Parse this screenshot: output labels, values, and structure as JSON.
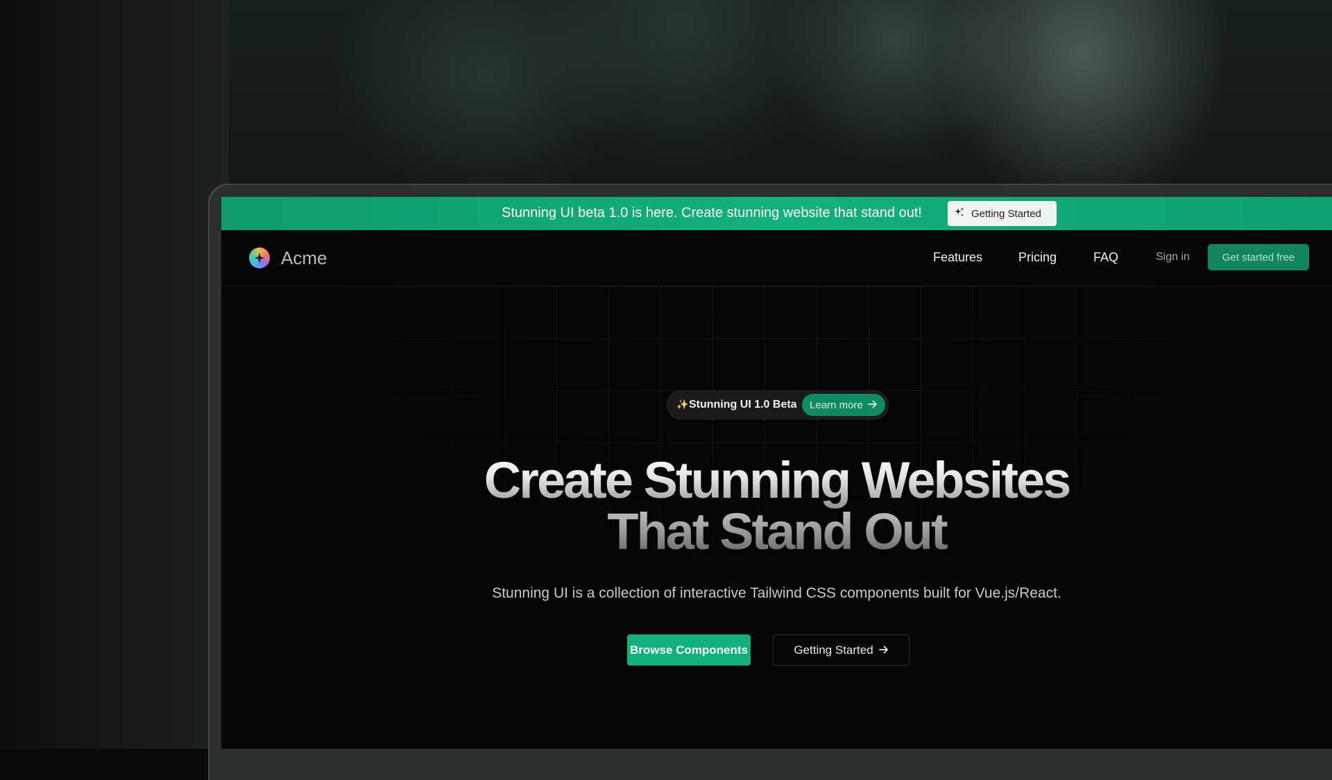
{
  "announcement": {
    "text": "Stunning UI beta 1.0 is here. Create stunning website that stand out!",
    "button_label": "Getting Started",
    "button_icon": "sparkles-icon"
  },
  "nav": {
    "brand": "Acme",
    "logo_icon": "acme-logo-icon",
    "links": [
      {
        "label": "Features"
      },
      {
        "label": "Pricing"
      },
      {
        "label": "FAQ"
      }
    ],
    "sign_in": "Sign in",
    "cta": "Get started free"
  },
  "hero": {
    "badge_text": "Stunning UI 1.0 Beta",
    "badge_icon": "sparkle-icon",
    "badge_link": "Learn more",
    "title_line1": "Create Stunning Websites",
    "title_line2": "That Stand Out",
    "subtitle": "Stunning UI is a collection of interactive Tailwind CSS components built for Vue.js/React.",
    "primary_button": "Browse Components",
    "secondary_button": "Getting Started"
  },
  "colors": {
    "accent": "#12b07c",
    "accent_dark": "#10855e",
    "background": "#050505"
  }
}
